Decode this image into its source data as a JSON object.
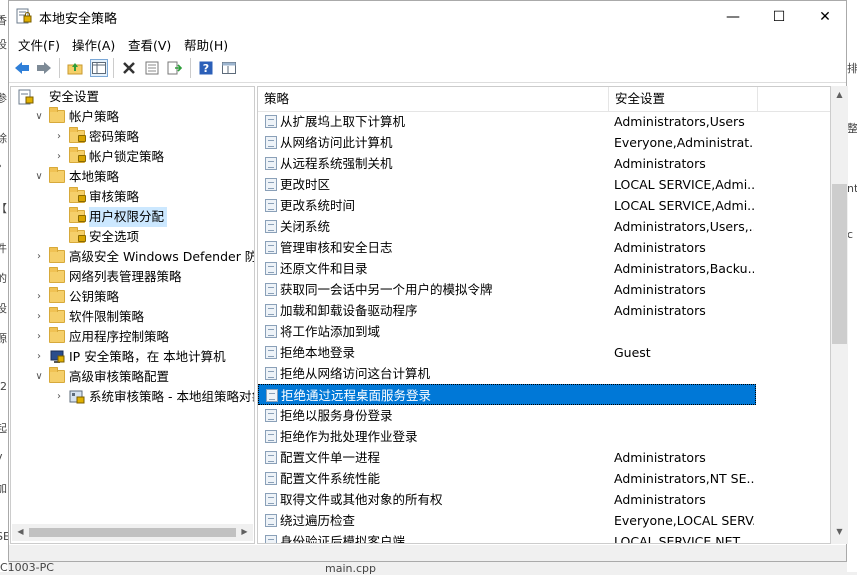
{
  "background": {
    "left_fragments": [
      "香",
      "设",
      "参",
      "除",
      "•",
      "【",
      "件",
      "的",
      "设",
      "源",
      "-2",
      "起",
      "v",
      "加",
      "SE"
    ],
    "right_fragments": [
      "排",
      "整",
      "nt",
      "c"
    ],
    "bottom_left": "C1003-PC",
    "bottom_file": "main.cpp"
  },
  "window": {
    "title": "本地安全策略",
    "minimize_icon": "—",
    "maximize_icon": "☐",
    "close_icon": "✕"
  },
  "menu": [
    "文件(F)",
    "操作(A)",
    "查看(V)",
    "帮助(H)"
  ],
  "toolbar": {
    "back": "back-arrow-icon",
    "forward": "forward-arrow-icon",
    "up": "up-folder-icon",
    "show_tree": "show-tree-icon",
    "delete": "delete-icon",
    "properties": "properties-icon",
    "export": "export-icon",
    "help": "help-icon",
    "view": "view-icon"
  },
  "tree": [
    {
      "label": "安全设置",
      "level": 0,
      "expander": "",
      "icon": "security-settings"
    },
    {
      "label": "帐户策略",
      "level": 1,
      "expander": "∨",
      "icon": "folder"
    },
    {
      "label": "密码策略",
      "level": 2,
      "expander": "›",
      "icon": "folder"
    },
    {
      "label": "帐户锁定策略",
      "level": 2,
      "expander": "›",
      "icon": "folder"
    },
    {
      "label": "本地策略",
      "level": 1,
      "expander": "∨",
      "icon": "folder"
    },
    {
      "label": "审核策略",
      "level": 2,
      "expander": "",
      "icon": "folder"
    },
    {
      "label": "用户权限分配",
      "level": 2,
      "expander": "",
      "icon": "folder",
      "selected": true
    },
    {
      "label": "安全选项",
      "level": 2,
      "expander": "",
      "icon": "folder"
    },
    {
      "label": "高级安全 Windows Defender 防火墙",
      "level": 1,
      "expander": "›",
      "icon": "folder"
    },
    {
      "label": "网络列表管理器策略",
      "level": 1,
      "expander": "",
      "icon": "folder"
    },
    {
      "label": "公钥策略",
      "level": 1,
      "expander": "›",
      "icon": "folder"
    },
    {
      "label": "软件限制策略",
      "level": 1,
      "expander": "›",
      "icon": "folder"
    },
    {
      "label": "应用程序控制策略",
      "level": 1,
      "expander": "›",
      "icon": "folder"
    },
    {
      "label": "IP 安全策略，在 本地计算机",
      "level": 1,
      "expander": "›",
      "icon": "ipsec"
    },
    {
      "label": "高级审核策略配置",
      "level": 1,
      "expander": "∨",
      "icon": "folder"
    },
    {
      "label": "系统审核策略 - 本地组策略对象",
      "level": 2,
      "expander": "›",
      "icon": "audit"
    }
  ],
  "list": {
    "columns": [
      "策略",
      "安全设置"
    ],
    "sort_glyph": "˄",
    "rows": [
      {
        "policy": "从扩展坞上取下计算机",
        "setting": "Administrators,Users"
      },
      {
        "policy": "从网络访问此计算机",
        "setting": "Everyone,Administrat..."
      },
      {
        "policy": "从远程系统强制关机",
        "setting": "Administrators"
      },
      {
        "policy": "更改时区",
        "setting": "LOCAL SERVICE,Admi..."
      },
      {
        "policy": "更改系统时间",
        "setting": "LOCAL SERVICE,Admi..."
      },
      {
        "policy": "关闭系统",
        "setting": "Administrators,Users,..."
      },
      {
        "policy": "管理审核和安全日志",
        "setting": "Administrators"
      },
      {
        "policy": "还原文件和目录",
        "setting": "Administrators,Backu..."
      },
      {
        "policy": "获取同一会话中另一个用户的模拟令牌",
        "setting": "Administrators"
      },
      {
        "policy": "加载和卸载设备驱动程序",
        "setting": "Administrators"
      },
      {
        "policy": "将工作站添加到域",
        "setting": ""
      },
      {
        "policy": "拒绝本地登录",
        "setting": "Guest"
      },
      {
        "policy": "拒绝从网络访问这台计算机",
        "setting": ""
      },
      {
        "policy": "拒绝通过远程桌面服务登录",
        "setting": "",
        "selected": true
      },
      {
        "policy": "拒绝以服务身份登录",
        "setting": ""
      },
      {
        "policy": "拒绝作为批处理作业登录",
        "setting": ""
      },
      {
        "policy": "配置文件单一进程",
        "setting": "Administrators"
      },
      {
        "policy": "配置文件系统性能",
        "setting": "Administrators,NT SE..."
      },
      {
        "policy": "取得文件或其他对象的所有权",
        "setting": "Administrators"
      },
      {
        "policy": "绕过遍历检查",
        "setting": "Everyone,LOCAL SERV..."
      },
      {
        "policy": "身份验证后模拟客户端",
        "setting": "LOCAL SERVICE,NET..."
      }
    ]
  },
  "colors": {
    "selection": "#0078d7",
    "tree_selection": "#cce8ff",
    "folder": "#f5cf6a"
  }
}
